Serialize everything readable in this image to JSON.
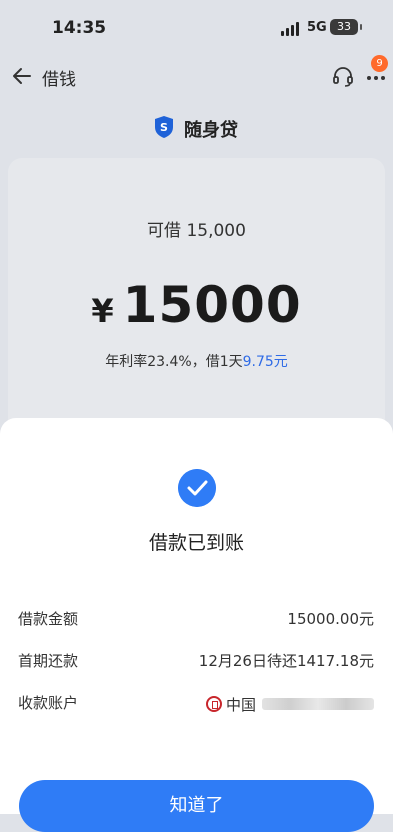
{
  "status_bar": {
    "time": "14:35",
    "network": "5G",
    "battery": "33"
  },
  "nav": {
    "title": "借钱",
    "badge": "9",
    "back_icon": "back-arrow-icon",
    "support_icon": "headset-icon",
    "more_icon": "more-icon"
  },
  "product": {
    "name": "随身贷",
    "logo_icon": "shield-s-icon"
  },
  "quota": {
    "label": "可借 15,000",
    "currency": "¥",
    "amount": "15000",
    "rate_text": "年利率23.4%，借1天",
    "rate_value": "9.75元"
  },
  "sheet": {
    "title": "借款已到账",
    "rows": [
      {
        "label": "借款金额",
        "value": "15000.00元"
      },
      {
        "label": "首期还款",
        "value": "12月26日待还1417.18元"
      },
      {
        "label": "收款账户",
        "value": "中国"
      }
    ],
    "button_label": "知道了"
  },
  "colors": {
    "accent": "#2f7cf6",
    "rate_blue": "#2f6be6",
    "badge": "#ff6a2b",
    "bank_red": "#c8262c"
  }
}
